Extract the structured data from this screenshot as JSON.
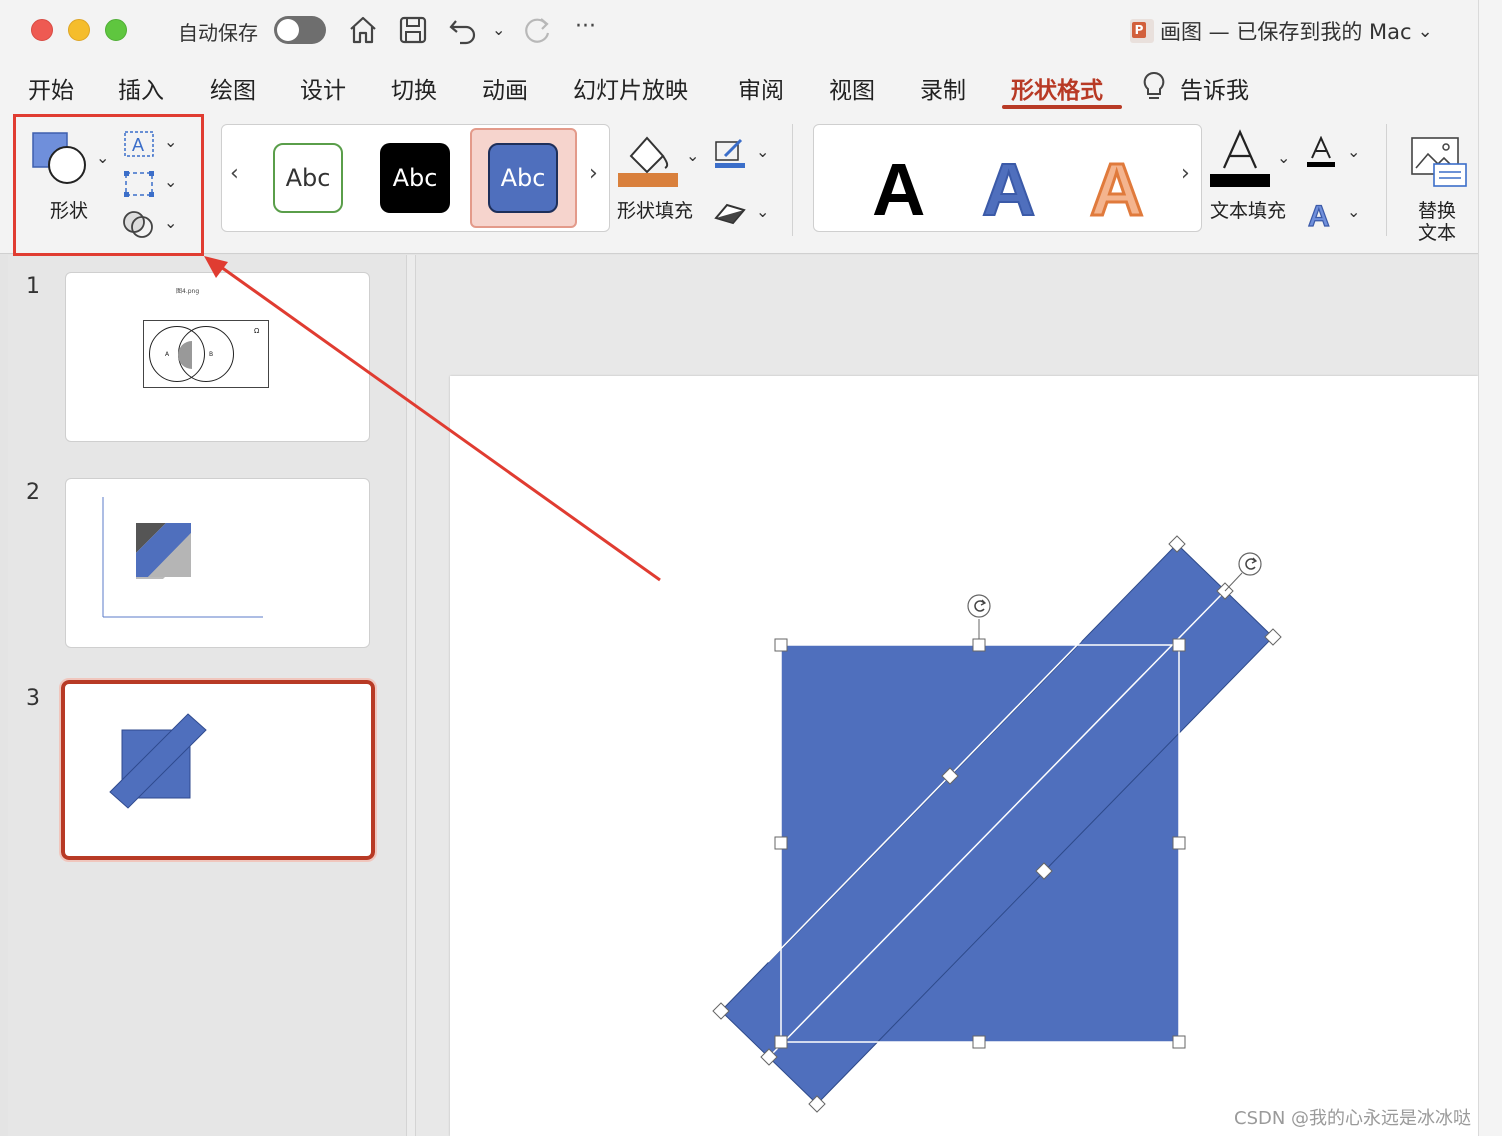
{
  "titlebar": {
    "autosave_label": "自动保存",
    "more": "···",
    "doc_title": "画图 — 已保存到我的 Mac",
    "doc_chevron": "⌄"
  },
  "tabs": [
    {
      "label": "开始"
    },
    {
      "label": "插入"
    },
    {
      "label": "绘图"
    },
    {
      "label": "设计"
    },
    {
      "label": "切换"
    },
    {
      "label": "动画"
    },
    {
      "label": "幻灯片放映"
    },
    {
      "label": "审阅"
    },
    {
      "label": "视图"
    },
    {
      "label": "录制"
    },
    {
      "label": "形状格式",
      "active": true
    },
    {
      "label": "告诉我"
    }
  ],
  "ribbon": {
    "shapes_label": "形状",
    "style_samples": [
      "Abc",
      "Abc",
      "Abc"
    ],
    "shape_fill_label": "形状填充",
    "wordart_samples": [
      "A",
      "A",
      "A"
    ],
    "text_fill_label": "文本填充",
    "alt_text_label_line1": "替换",
    "alt_text_label_line2": "文本",
    "prev": "‹",
    "next": "›",
    "chev": "⌄"
  },
  "slides": [
    {
      "number": "1",
      "caption": "图4.png",
      "circle_a": "A",
      "circle_b": "B",
      "omega": "Ω"
    },
    {
      "number": "2"
    },
    {
      "number": "3",
      "selected": true
    }
  ],
  "colors": {
    "accent_tab": "#b83a25",
    "shape_blue": "#4f6fbd",
    "highlight_red": "#e03c31",
    "fill_orange": "#d9803c"
  },
  "watermark": "CSDN @我的心永远是冰冰哒"
}
